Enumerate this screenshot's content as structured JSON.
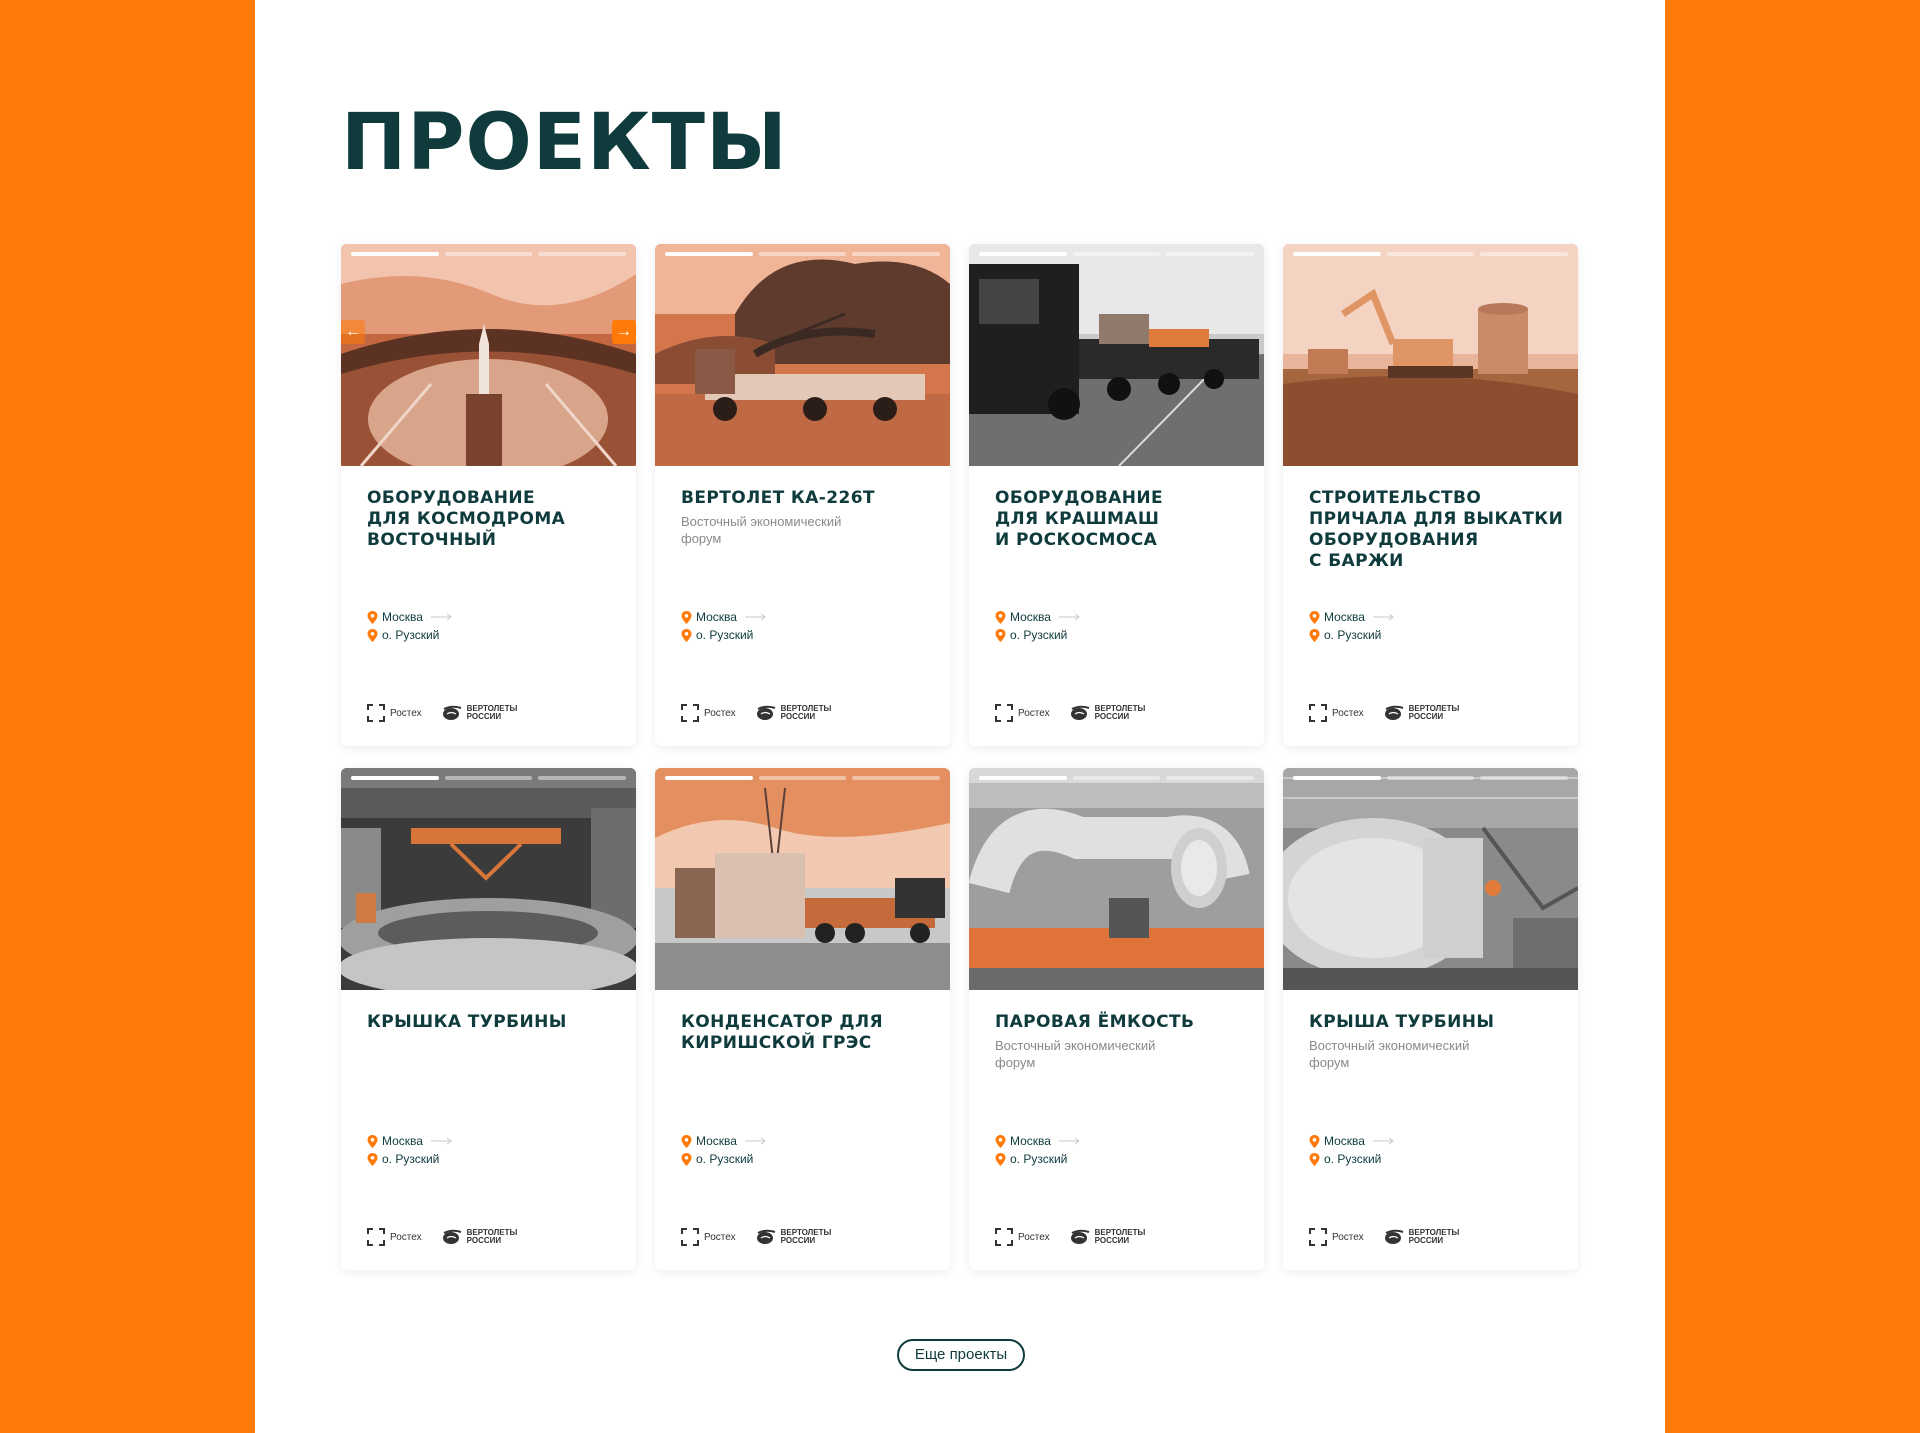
{
  "page": {
    "title": "ПРОЕКТЫ",
    "more_button": "Еще проекты"
  },
  "colors": {
    "accent": "#ff7a08",
    "text_dark": "#0f3b3d",
    "muted": "#8a8a8a"
  },
  "cards": [
    {
      "title": "ОБОРУДОВАНИЕ\nДЛЯ КОСМОДРОМА\nВОСТОЧНЫЙ",
      "subtitle": "",
      "location_from": "Москва",
      "location_to": "о. Рузский",
      "partner_1": "Ростех",
      "partner_2": "ВЕРТОЛЕТЫ РОССИИ",
      "image": "cosmodrome-launch-pad-photo",
      "has_arrows": true
    },
    {
      "title": "ВЕРТОЛЕТ КА-226Т",
      "subtitle": "Восточный экономический форум",
      "location_from": "Москва",
      "location_to": "о. Рузский",
      "partner_1": "Ростех",
      "partner_2": "ВЕРТОЛЕТЫ РОССИИ",
      "image": "helicopter-on-truck-photo",
      "has_arrows": false
    },
    {
      "title": "ОБОРУДОВАНИЕ\nДЛЯ КРАШМАШ\nИ РОСКОСМОСА",
      "subtitle": "",
      "location_from": "Москва",
      "location_to": "о. Рузский",
      "partner_1": "Ростех",
      "partner_2": "ВЕРТОЛЕТЫ РОССИИ",
      "image": "heavy-truck-convoy-photo",
      "has_arrows": false
    },
    {
      "title": "СТРОИТЕЛЬСТВО\nПРИЧАЛА ДЛЯ ВЫКАТКИ\nОБОРУДОВАНИЯ\nС БАРЖИ",
      "subtitle": "",
      "location_from": "Москва",
      "location_to": "о. Рузский",
      "partner_1": "Ростех",
      "partner_2": "ВЕРТОЛЕТЫ РОССИИ",
      "image": "excavator-field-photo",
      "has_arrows": false
    },
    {
      "title": "КРЫШКА ТУРБИНЫ",
      "subtitle": "",
      "location_from": "Москва",
      "location_to": "о. Рузский",
      "partner_1": "Ростех",
      "partner_2": "ВЕРТОЛЕТЫ РОССИИ",
      "image": "turbine-cover-workshop-photo",
      "has_arrows": false
    },
    {
      "title": "КОНДЕНСАТОР ДЛЯ\nКИРИШСКОЙ ГРЭС",
      "subtitle": "",
      "location_from": "Москва",
      "location_to": "о. Рузский",
      "partner_1": "Ростех",
      "partner_2": "ВЕРТОЛЕТЫ РОССИИ",
      "image": "condenser-transport-photo",
      "has_arrows": false
    },
    {
      "title": "ПАРОВАЯ ЁМКОСТЬ",
      "subtitle": "Восточный экономический форум",
      "location_from": "Москва",
      "location_to": "о. Рузский",
      "partner_1": "Ростех",
      "partner_2": "ВЕРТОЛЕТЫ РОССИИ",
      "image": "steam-vessel-photo",
      "has_arrows": false
    },
    {
      "title": "КРЫША ТУРБИНЫ",
      "subtitle": "Восточный экономический форум",
      "location_from": "Москва",
      "location_to": "о. Рузский",
      "partner_1": "Ростех",
      "partner_2": "ВЕРТОЛЕТЫ РОССИИ",
      "image": "turbine-roof-factory-photo",
      "has_arrows": false
    }
  ]
}
